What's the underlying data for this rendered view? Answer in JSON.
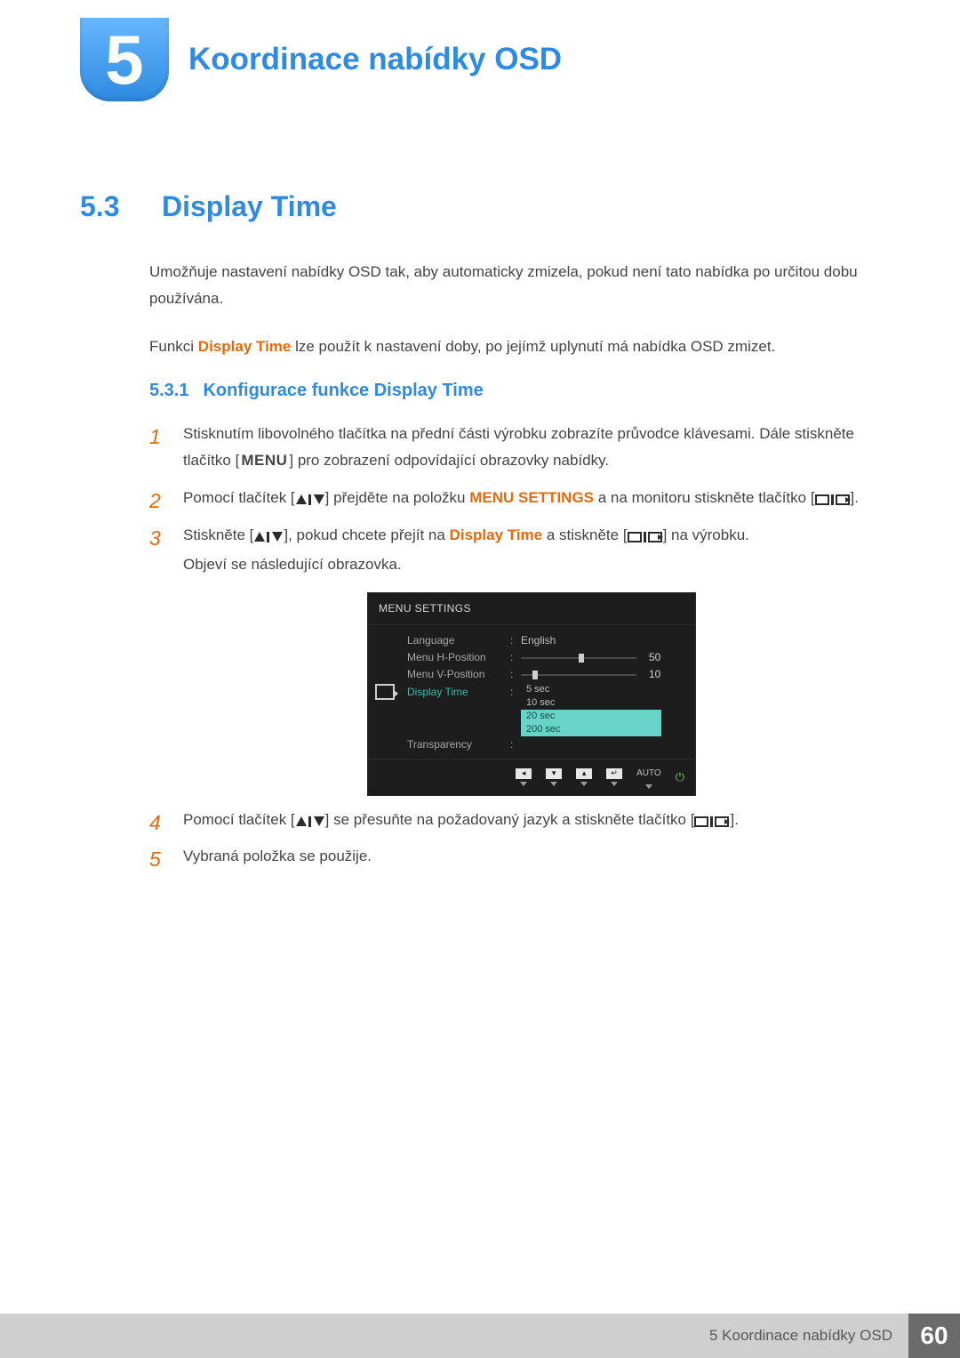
{
  "chapter": {
    "number": "5",
    "title": "Koordinace nabídky OSD"
  },
  "section": {
    "number": "5.3",
    "title": "Display Time"
  },
  "intro": {
    "p1": "Umožňuje nastavení nabídky OSD tak, aby automaticky zmizela, pokud není tato nabídka po určitou dobu používána.",
    "p2a": "Funkci ",
    "p2_strong": "Display Time",
    "p2b": " lze použít k nastavení doby, po jejímž uplynutí má nabídka OSD zmizet."
  },
  "subsection": {
    "number": "5.3.1",
    "title": "Konfigurace funkce Display Time"
  },
  "steps": {
    "s1a": "Stisknutím libovolného tlačítka na přední části výrobku zobrazíte průvodce klávesami. Dále stiskněte tlačítko [",
    "s1_menu": "MENU",
    "s1b": "] pro zobrazení odpovídající obrazovky nabídky.",
    "s2a": "Pomocí tlačítek [",
    "s2b": "] přejděte na položku ",
    "s2_strong": "MENU SETTINGS",
    "s2c": " a na monitoru stiskněte tlačítko [",
    "s2d": "].",
    "s3a": "Stiskněte [",
    "s3b": "], pokud chcete přejít na ",
    "s3_strong": "Display Time",
    "s3c": " a stiskněte [",
    "s3d": "] na výrobku.",
    "s3e": "Objeví se následující obrazovka.",
    "s4a": "Pomocí tlačítek [",
    "s4b": "] se přesuňte na požadovaný jazyk a stiskněte tlačítko [",
    "s4c": "].",
    "s5": "Vybraná položka se použije."
  },
  "osd": {
    "title": "MENU SETTINGS",
    "rows": {
      "language": {
        "label": "Language",
        "value": "English"
      },
      "hpos": {
        "label": "Menu H-Position",
        "value": "50",
        "knob_pct": 50
      },
      "vpos": {
        "label": "Menu V-Position",
        "value": "10",
        "knob_pct": 10
      },
      "dtime": {
        "label": "Display Time",
        "options": [
          "5 sec",
          "10 sec",
          "20 sec",
          "200 sec"
        ],
        "highlight_index": 2
      },
      "transp": {
        "label": "Transparency"
      }
    },
    "foot": {
      "auto": "AUTO"
    }
  },
  "footer": {
    "label": "5 Koordinace nabídky OSD",
    "page": "60"
  }
}
